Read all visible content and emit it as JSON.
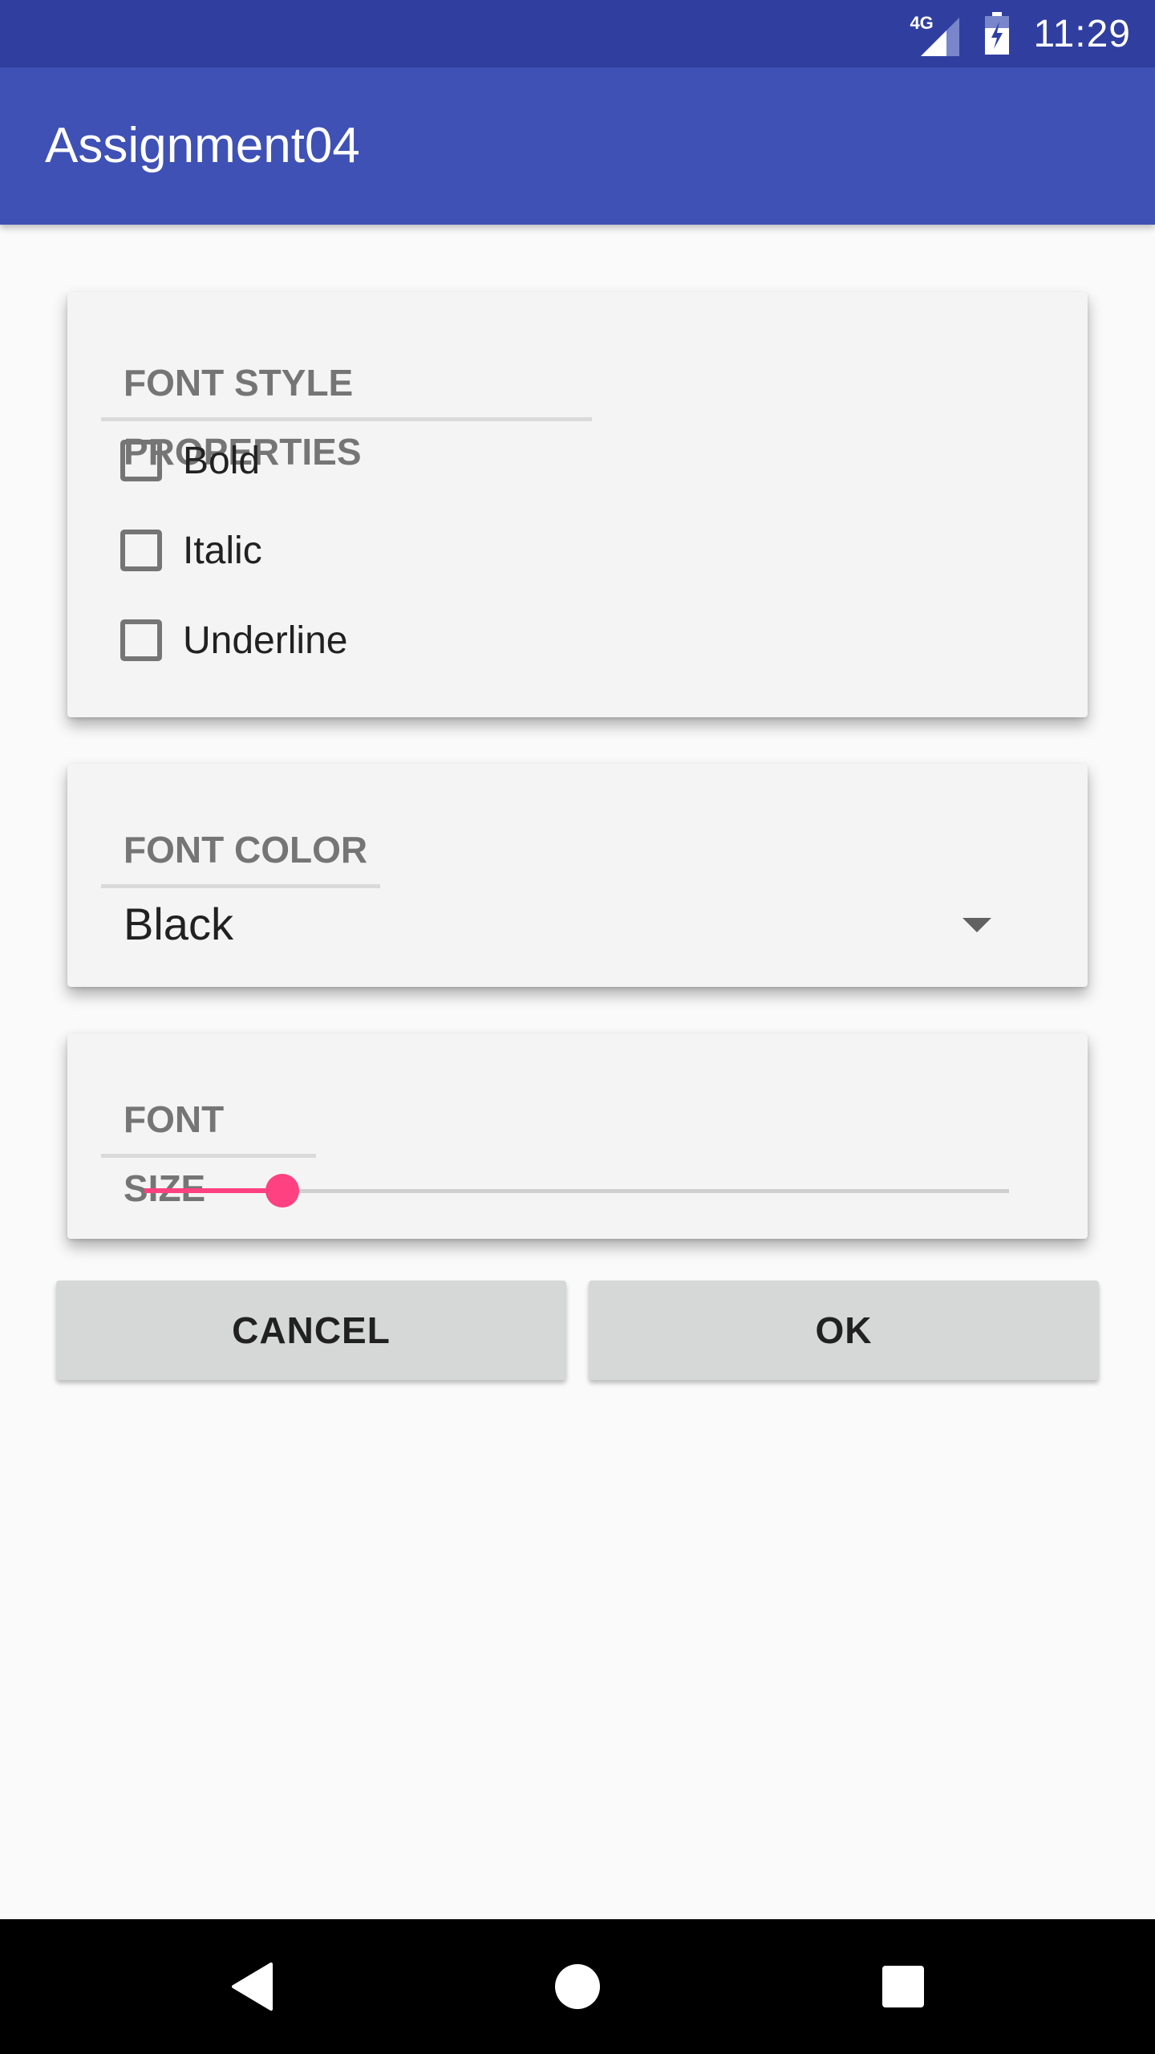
{
  "status_bar": {
    "network": "4G",
    "time": "11:29",
    "icons": [
      "signal-icon",
      "battery-charging-icon"
    ]
  },
  "app_bar": {
    "title": "Assignment04",
    "background": "#3f51b5"
  },
  "font_style": {
    "header": "FONT STYLE PROPERTIES",
    "options": [
      {
        "label": "Bold",
        "checked": false
      },
      {
        "label": "Italic",
        "checked": false
      },
      {
        "label": "Underline",
        "checked": false
      }
    ]
  },
  "font_color": {
    "header": "FONT COLOR",
    "selected": "Black"
  },
  "font_size": {
    "header": "FONT SIZE",
    "slider_fraction": 0.16,
    "accent": "#ff4081"
  },
  "buttons": {
    "cancel": "CANCEL",
    "ok": "OK"
  },
  "nav_bar": {
    "icons": [
      "back-icon",
      "home-icon",
      "recents-icon"
    ]
  }
}
